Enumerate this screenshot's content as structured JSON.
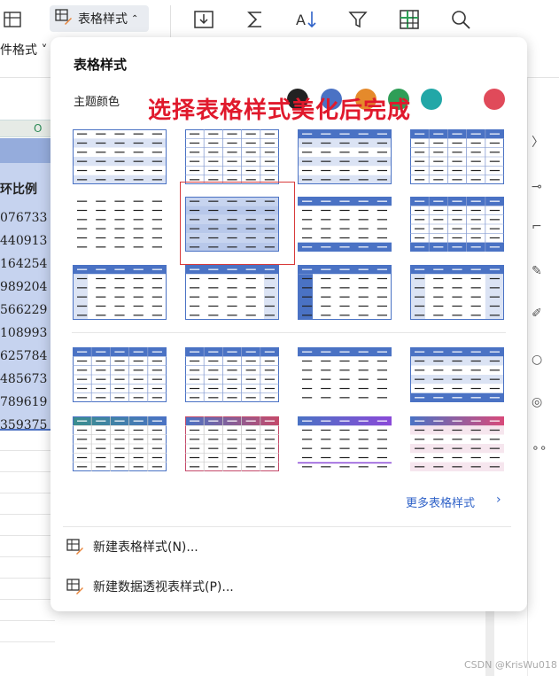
{
  "toolbar": {
    "table_style_label": "表格样式",
    "format_label": "件格式"
  },
  "popup": {
    "title": "表格样式",
    "theme_color_label": "主题颜色",
    "theme_colors": [
      "#222222",
      "#4a72c4",
      "#e58a2b",
      "#2f9e57",
      "#22a7a7",
      "#e04a5a"
    ],
    "annotation": "选择表格样式美化后完成",
    "more_styles": "更多表格样式",
    "menu": [
      {
        "label": "新建表格样式(N)..."
      },
      {
        "label": "新建数据透视表样式(P)..."
      }
    ],
    "styles": [
      {
        "variant": "light-band",
        "accent": "#4a72c4"
      },
      {
        "variant": "light-grid",
        "accent": "#4a72c4"
      },
      {
        "variant": "head-band",
        "accent": "#4a72c4"
      },
      {
        "variant": "head-grid",
        "accent": "#4a72c4"
      },
      {
        "variant": "plain",
        "accent": "#4a72c4"
      },
      {
        "variant": "full-fill",
        "accent": "#4a72c4",
        "selected": true
      },
      {
        "variant": "head-foot",
        "accent": "#4a72c4"
      },
      {
        "variant": "head-foot-grid",
        "accent": "#4a72c4"
      },
      {
        "variant": "head-side",
        "accent": "#4a72c4"
      },
      {
        "variant": "head-last",
        "accent": "#4a72c4"
      },
      {
        "variant": "head-side-dark",
        "accent": "#4a72c4"
      },
      {
        "variant": "head-side-cols",
        "accent": "#4a72c4"
      },
      {
        "variant": "head-grid",
        "accent": "#4a72c4"
      },
      {
        "variant": "head-grid",
        "accent": "#4a72c4"
      },
      {
        "variant": "head-only",
        "accent": "#4a72c4"
      },
      {
        "variant": "head-band-foot",
        "accent": "#4a72c4"
      },
      {
        "variant": "grad-grid",
        "accent": "#3a8e8e",
        "accent2": "#4a72c4"
      },
      {
        "variant": "grad-grid",
        "accent": "#4a72c4",
        "accent2": "#c44a6a"
      },
      {
        "variant": "grad-head",
        "accent": "#4a72c4",
        "accent2": "#8a4ad8"
      },
      {
        "variant": "grad-pink",
        "accent": "#4a72c4",
        "accent2": "#d84a7a"
      }
    ]
  },
  "sheet": {
    "header_fragment": "O",
    "title_fragment": "环比例",
    "values": [
      "076733",
      "440913",
      "164254",
      "989204",
      "566229",
      "108993",
      "625784",
      "485673",
      "789619",
      "359375"
    ]
  },
  "watermark": "CSDN @KrisWu018"
}
